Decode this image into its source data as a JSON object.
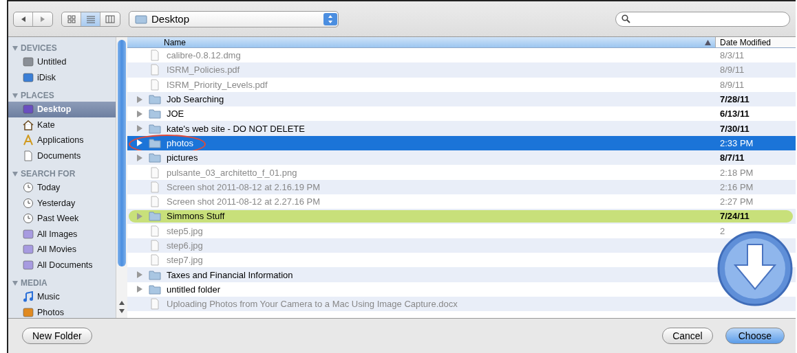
{
  "toolbar": {
    "view_modes": [
      {
        "kind": "icons",
        "selected": false
      },
      {
        "kind": "list",
        "selected": true
      },
      {
        "kind": "columns",
        "selected": false
      }
    ],
    "location": "Desktop"
  },
  "sidebar": [
    {
      "heading": "DEVICES",
      "items": [
        {
          "label": "Untitled",
          "kind": "drive",
          "selected": false
        },
        {
          "label": "iDisk",
          "kind": "idisk",
          "selected": false
        }
      ]
    },
    {
      "heading": "PLACES",
      "items": [
        {
          "label": "Desktop",
          "kind": "desktop",
          "selected": true
        },
        {
          "label": "Kate",
          "kind": "home",
          "selected": false
        },
        {
          "label": "Applications",
          "kind": "apps",
          "selected": false
        },
        {
          "label": "Documents",
          "kind": "doc",
          "selected": false
        }
      ]
    },
    {
      "heading": "SEARCH FOR",
      "items": [
        {
          "label": "Today",
          "kind": "clock",
          "selected": false
        },
        {
          "label": "Yesterday",
          "kind": "clock",
          "selected": false
        },
        {
          "label": "Past Week",
          "kind": "clock",
          "selected": false
        },
        {
          "label": "All Images",
          "kind": "smart",
          "selected": false
        },
        {
          "label": "All Movies",
          "kind": "smart",
          "selected": false
        },
        {
          "label": "All Documents",
          "kind": "smart",
          "selected": false
        }
      ]
    },
    {
      "heading": "MEDIA",
      "items": [
        {
          "label": "Music",
          "kind": "music",
          "selected": false
        },
        {
          "label": "Photos",
          "kind": "photos",
          "selected": false
        }
      ]
    }
  ],
  "table": {
    "columns": [
      "Name",
      "Date Modified"
    ],
    "rows": [
      {
        "name": "calibre-0.8.12.dmg",
        "date": "8/3/11",
        "kind": "file",
        "enabled": false,
        "selected": false
      },
      {
        "name": "ISRM_Policies.pdf",
        "date": "8/9/11",
        "kind": "file",
        "enabled": false,
        "selected": false
      },
      {
        "name": "ISRM_Priority_Levels.pdf",
        "date": "8/9/11",
        "kind": "file",
        "enabled": false,
        "selected": false
      },
      {
        "name": "Job Searching",
        "date": "7/28/11",
        "kind": "folder",
        "enabled": true,
        "selected": false
      },
      {
        "name": "JOE",
        "date": "6/13/11",
        "kind": "folder",
        "enabled": true,
        "selected": false
      },
      {
        "name": "kate's web site - DO NOT DELETE",
        "date": "7/30/11",
        "kind": "folder",
        "enabled": true,
        "selected": false
      },
      {
        "name": "photos",
        "date": "2:33 PM",
        "kind": "folder",
        "enabled": true,
        "selected": true,
        "circled": true
      },
      {
        "name": "pictures",
        "date": "8/7/11",
        "kind": "folder",
        "enabled": true,
        "selected": false
      },
      {
        "name": "pulsante_03_architetto_f_01.png",
        "date": "2:18 PM",
        "kind": "file",
        "enabled": false,
        "selected": false
      },
      {
        "name": "Screen shot 2011-08-12 at 2.16.19 PM",
        "date": "2:16 PM",
        "kind": "file",
        "enabled": false,
        "selected": false
      },
      {
        "name": "Screen shot 2011-08-12 at 2.27.16 PM",
        "date": "2:27 PM",
        "kind": "file",
        "enabled": false,
        "selected": false
      },
      {
        "name": "Simmons Stuff",
        "date": "7/24/11",
        "kind": "folder",
        "enabled": true,
        "selected": false,
        "color": "#c8e07a"
      },
      {
        "name": "step5.jpg",
        "date": "2",
        "kind": "file",
        "enabled": false,
        "selected": false
      },
      {
        "name": "step6.jpg",
        "kind": "file",
        "enabled": false,
        "selected": false
      },
      {
        "name": "step7.jpg",
        "kind": "file",
        "enabled": false,
        "selected": false
      },
      {
        "name": "Taxes and Financial Information",
        "kind": "folder",
        "enabled": true,
        "selected": false
      },
      {
        "name": "untitled folder",
        "kind": "folder",
        "enabled": true,
        "selected": false
      },
      {
        "name": "Uploading Photos from Your Camera to a Mac Using Image Capture.docx",
        "kind": "file",
        "enabled": false,
        "selected": false
      }
    ]
  },
  "buttons": [
    {
      "label": "New Folder",
      "kind": "plain"
    },
    {
      "label": "Cancel",
      "kind": "plain"
    },
    {
      "label": "Choose",
      "kind": "default"
    }
  ]
}
